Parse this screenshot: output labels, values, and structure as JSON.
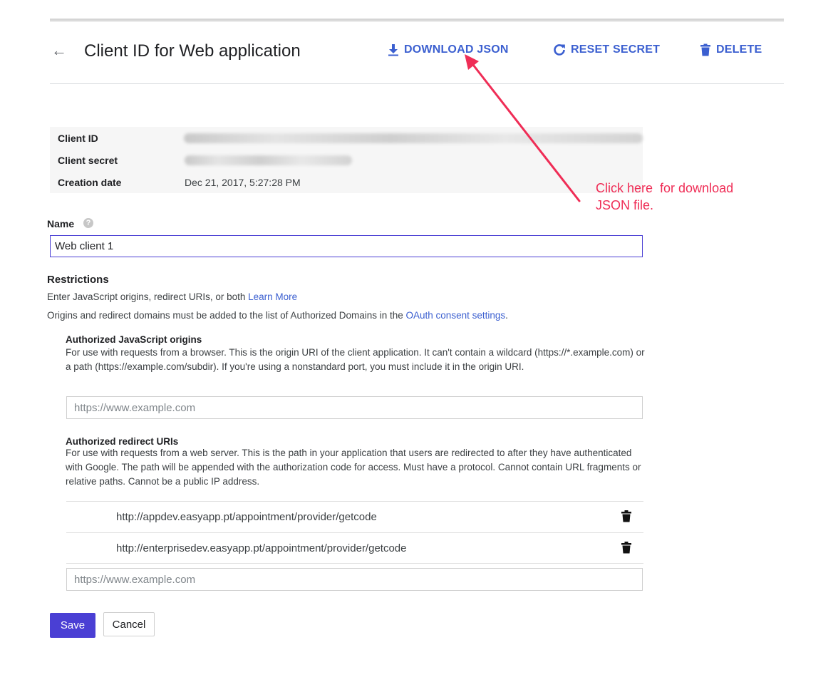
{
  "header": {
    "back_glyph": "←",
    "title": "Client ID for Web application",
    "download_label": "DOWNLOAD JSON",
    "reset_label": "RESET SECRET",
    "delete_label": "DELETE"
  },
  "info": {
    "client_id_label": "Client ID",
    "client_secret_label": "Client secret",
    "creation_date_label": "Creation date",
    "creation_date_value": "Dec 21, 2017, 5:27:28 PM"
  },
  "annotation": {
    "text": "Click here  for download\nJSON file."
  },
  "name_section": {
    "label": "Name",
    "help_glyph": "?",
    "value": "Web client 1"
  },
  "restrictions": {
    "title": "Restrictions",
    "line1_prefix": "Enter JavaScript origins, redirect URIs, or both ",
    "learn_more": "Learn More",
    "line2_prefix": "Origins and redirect domains must be added to the list of Authorized Domains in the ",
    "oauth_link": "OAuth consent settings",
    "line2_suffix": "."
  },
  "js_origins": {
    "title": "Authorized JavaScript origins",
    "description": "For use with requests from a browser. This is the origin URI of the client application. It can't contain a wildcard (https://*.example.com) or a path (https://example.com/subdir). If you're using a nonstandard port, you must include it in the origin URI.",
    "placeholder": "https://www.example.com"
  },
  "redirect_uris": {
    "title": "Authorized redirect URIs",
    "description": "For use with requests from a web server. This is the path in your application that users are redirected to after they have authenticated with Google. The path will be appended with the authorization code for access. Must have a protocol. Cannot contain URL fragments or relative paths. Cannot be a public IP address.",
    "items": [
      "http://appdev.easyapp.pt/appointment/provider/getcode",
      "http://enterprisedev.easyapp.pt/appointment/provider/getcode"
    ],
    "placeholder": "https://www.example.com"
  },
  "actions": {
    "save": "Save",
    "cancel": "Cancel"
  },
  "colors": {
    "accent": "#3b5fd0",
    "primary_button": "#4a3fd4",
    "annotation": "#ef2d56"
  },
  "icons": {
    "download": "download-icon",
    "reset": "refresh-icon",
    "delete": "trash-icon",
    "help": "help-icon"
  }
}
